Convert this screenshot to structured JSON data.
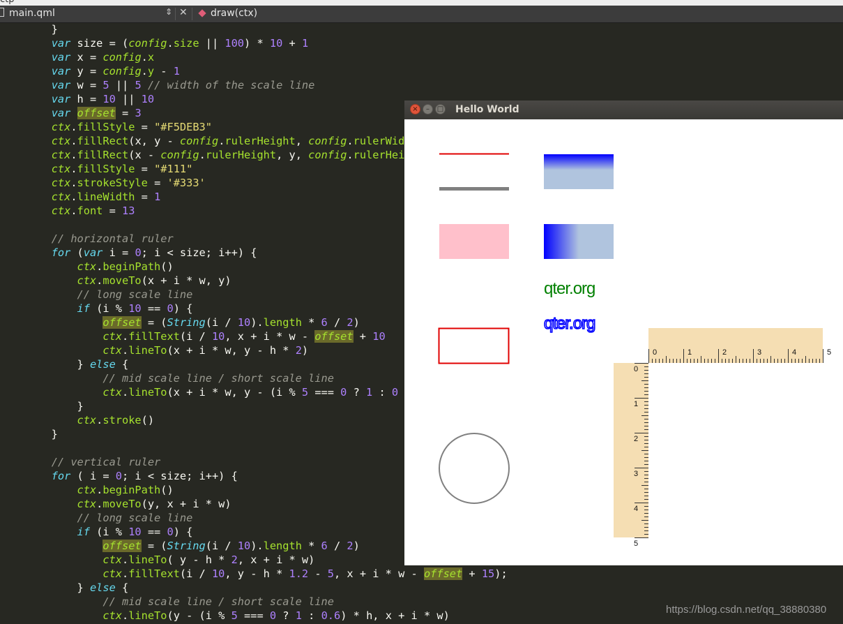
{
  "top_strip_label": "ctp",
  "editor": {
    "file_name": "main.qml",
    "function_name": "draw(ctx)"
  },
  "code_lines": [
    "        }",
    "        var size = (config.size || 100) * 10 + 1",
    "        var x = config.x",
    "        var y = config.y - 1",
    "        var w = 5 || 5 // width of the scale line",
    "        var h = 10 || 10",
    "        var offset = 3",
    "        ctx.fillStyle = \"#F5DEB3\"",
    "        ctx.fillRect(x, y - config.rulerHeight, config.rulerWidth",
    "        ctx.fillRect(x - config.rulerHeight, y, config.rulerHeight",
    "        ctx.fillStyle = \"#111\"",
    "        ctx.strokeStyle = '#333'",
    "        ctx.lineWidth = 1",
    "        ctx.font = 13",
    "",
    "        // horizontal ruler",
    "        for (var i = 0; i < size; i++) {",
    "            ctx.beginPath()",
    "            ctx.moveTo(x + i * w, y)",
    "            // long scale line",
    "            if (i % 10 == 0) {",
    "                offset = (String(i / 10).length * 6 / 2)",
    "                ctx.fillText(i / 10, x + i * w - offset + 10",
    "                ctx.lineTo(x + i * w, y - h * 2)",
    "            } else {",
    "                // mid scale line / short scale line",
    "                ctx.lineTo(x + i * w, y - (i % 5 === 0 ? 1 : 0",
    "            }",
    "            ctx.stroke()",
    "        }",
    "",
    "        // vertical ruler",
    "        for ( i = 0; i < size; i++) {",
    "            ctx.beginPath()",
    "            ctx.moveTo(y, x + i * w)",
    "            // long scale line",
    "            if (i % 10 == 0) {",
    "                offset = (String(i / 10).length * 6 / 2)",
    "                ctx.lineTo( y - h * 2, x + i * w)",
    "                ctx.fillText(i / 10, y - h * 1.2 - 5, x + i * w - offset + 15);",
    "            } else {",
    "                // mid scale line / short scale line",
    "                ctx.lineTo(y - (i % 5 === 0 ? 1 : 0.6) * h, x + i * w)"
  ],
  "window": {
    "title": "Hello World",
    "close_glyph": "×",
    "minimize_glyph": "–",
    "maximize_glyph": "□"
  },
  "canvas": {
    "text_filled": "qter.org",
    "text_stroked": "qter.org",
    "colors": {
      "red_line": "#e00000",
      "gray_line": "#808080",
      "pink_rect": "#ffc0cb",
      "gradient_blue": "#0000ff",
      "gradient_steel": "#b0c4de",
      "green_text": "#008000",
      "stroke_text": "#0000ff",
      "red_rect_stroke": "#e00000",
      "circle_stroke": "#808080",
      "ruler_fill": "#F5DEB3",
      "ruler_tick": "#333333"
    },
    "ruler": {
      "units": 5,
      "ticks_per_unit": 10,
      "labels": [
        "0",
        "1",
        "2",
        "3",
        "4",
        "5"
      ]
    }
  },
  "watermark": "https://blog.csdn.net/qq_38880380"
}
